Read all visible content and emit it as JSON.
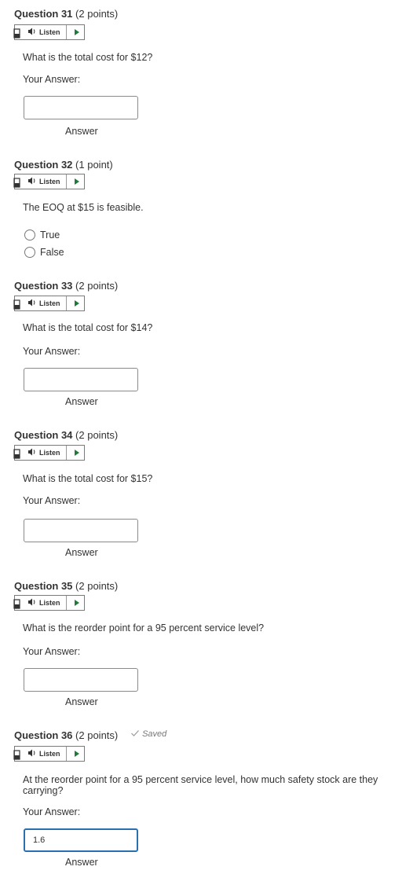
{
  "listen_label": "Listen",
  "your_answer_label": "Your Answer:",
  "answer_caption": "Answer",
  "questions": [
    {
      "title": "Question 31",
      "points": "(2 points)",
      "prompt": "What is the total cost for $12?",
      "value": ""
    },
    {
      "title": "Question 32",
      "points": "(1 point)",
      "prompt": "The EOQ at $15 is feasible.",
      "options": [
        "True",
        "False"
      ]
    },
    {
      "title": "Question 33",
      "points": "(2 points)",
      "prompt": "What is the total cost for $14?",
      "value": ""
    },
    {
      "title": "Question 34",
      "points": "(2 points)",
      "prompt": "What is the total cost for $15?",
      "value": ""
    },
    {
      "title": "Question 35",
      "points": "(2 points)",
      "prompt": "What is the reorder point for a 95 percent service level?",
      "value": ""
    },
    {
      "title": "Question 36",
      "points": "(2 points)",
      "saved": "Saved",
      "prompt": "At the reorder point for a 95 percent service level, how much safety stock are they carrying?",
      "value": "1.6"
    }
  ],
  "icons": {
    "book": "book-icon",
    "speaker": "speaker-icon",
    "play": "play-icon",
    "check": "check-icon"
  }
}
